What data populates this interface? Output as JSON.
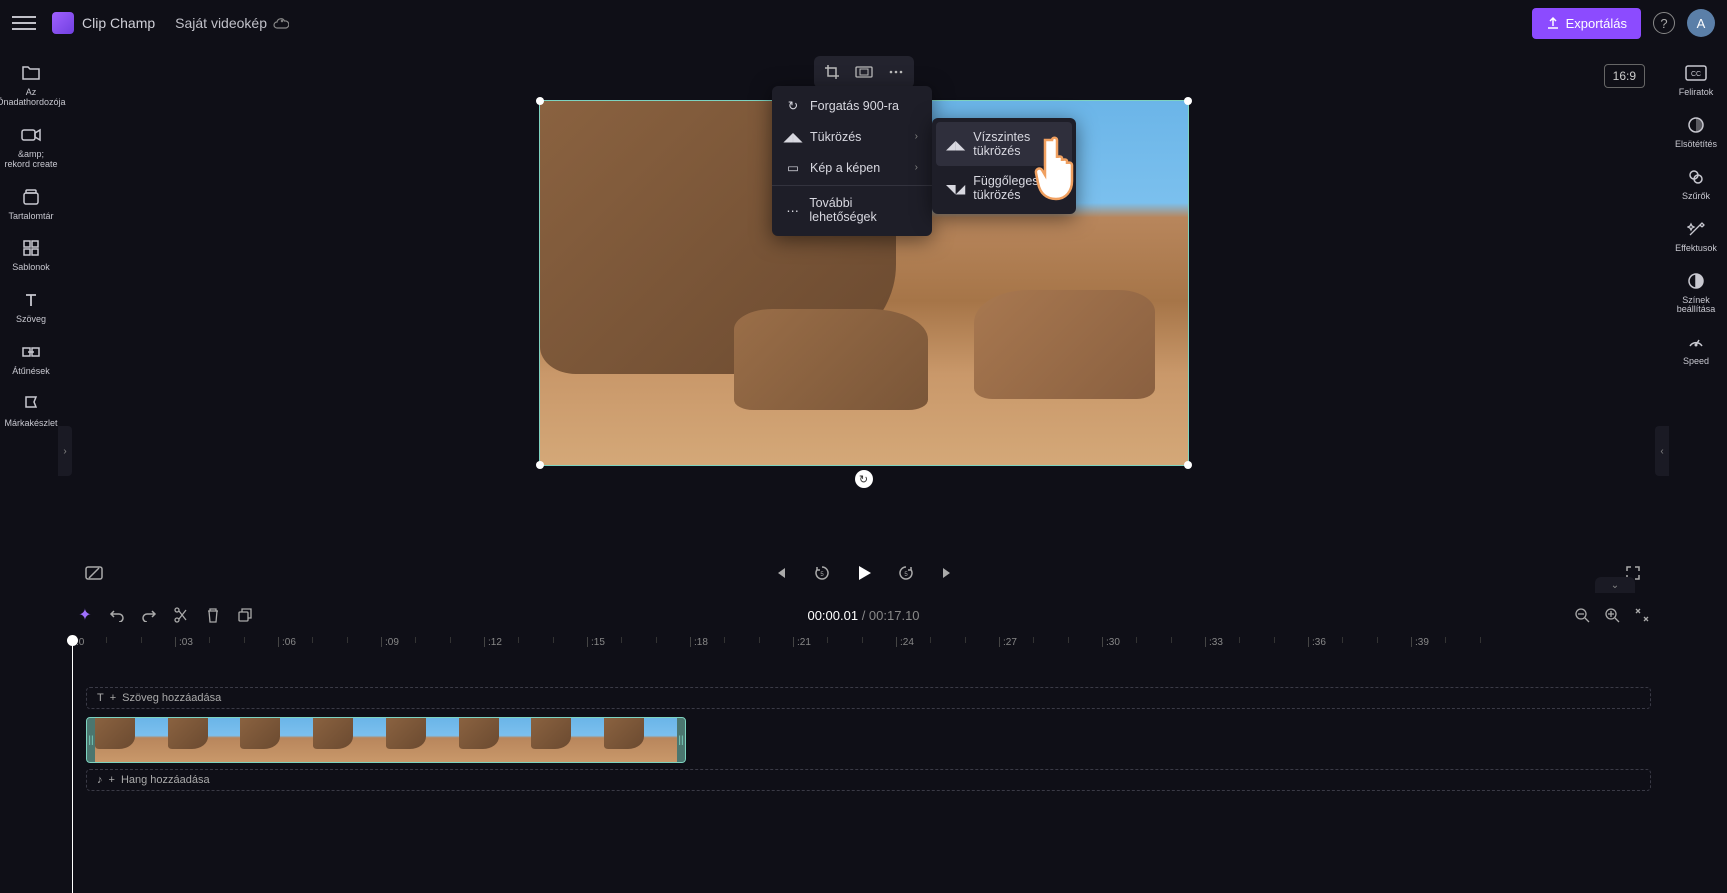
{
  "header": {
    "app_name": "Clip Champ",
    "project_name": "Saját videokép",
    "export_label": "Exportálás",
    "avatar_letter": "A"
  },
  "left_sidebar": {
    "items": [
      {
        "label": "Az Önadathordozója",
        "icon": "folder"
      },
      {
        "label": "&amp; rekord create",
        "icon": "camera"
      },
      {
        "label": "Tartalomtár",
        "icon": "library"
      },
      {
        "label": "Sablonok",
        "icon": "templates"
      },
      {
        "label": "Szöveg",
        "icon": "text"
      },
      {
        "label": "Átűnések",
        "icon": "transitions"
      },
      {
        "label": "Márkakészlet",
        "icon": "brand"
      }
    ]
  },
  "right_sidebar": {
    "items": [
      {
        "label": "Feliratok",
        "icon": "cc"
      },
      {
        "label": "Elsötétítés",
        "icon": "fade"
      },
      {
        "label": "Szűrők",
        "icon": "filters"
      },
      {
        "label": "Effektusok",
        "icon": "effects"
      },
      {
        "label": "Színek beállítása",
        "icon": "colors"
      },
      {
        "label": "Speed",
        "icon": "speed"
      }
    ]
  },
  "stage": {
    "aspect": "16:9"
  },
  "context_menu": {
    "items": [
      {
        "label": "Forgatás 900-ra",
        "icon": "rotate",
        "chevron": false
      },
      {
        "label": "Tükrözés",
        "icon": "flip",
        "chevron": true
      },
      {
        "label": "Kép a képen",
        "icon": "pip",
        "chevron": true
      }
    ],
    "more_label": "További lehetőségek"
  },
  "submenu": {
    "items": [
      {
        "label": "Vízszintes tükrözés",
        "active": true
      },
      {
        "label": "Függőleges tükrözés",
        "active": false
      }
    ]
  },
  "playback": {
    "current_time": "00:00.01",
    "duration": "00:17.10"
  },
  "ruler": {
    "ticks": [
      ":0",
      ":03",
      ":06",
      ":09",
      ":12",
      ":15",
      ":18",
      ":21",
      ":24",
      ":27",
      ":30",
      ":33",
      ":36",
      ":39"
    ]
  },
  "tracks": {
    "add_text_label": "Szöveg hozzáadása",
    "add_audio_label": "Hang hozzáadása",
    "clip_thumbs": 8
  }
}
